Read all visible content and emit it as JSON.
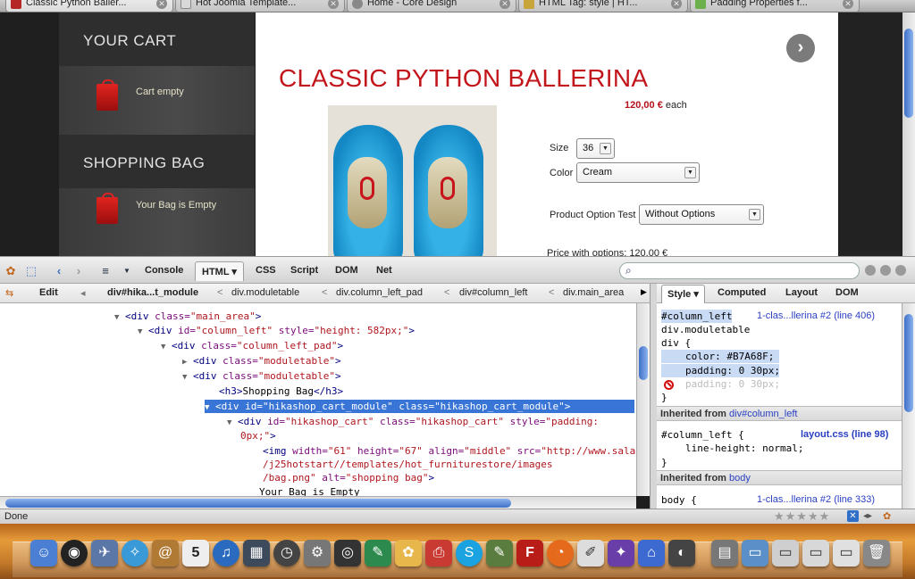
{
  "browser": {
    "tabs": [
      {
        "title": "Classic Python Baller...",
        "active": true
      },
      {
        "title": "Hot Joomla Template...",
        "active": false
      },
      {
        "title": "Home - Core Design",
        "active": false
      },
      {
        "title": "HTML Tag: style | HT...",
        "active": false
      },
      {
        "title": "Padding Properties f...",
        "active": false
      }
    ]
  },
  "site": {
    "cart": {
      "heading": "YOUR CART",
      "status": "Cart empty"
    },
    "shopping_bag": {
      "heading": "SHOPPING BAG",
      "status": "Your Bag is Empty"
    },
    "product": {
      "title": "CLASSIC PYTHON BALLERINA",
      "price": "120,00 €",
      "price_suffix": "each",
      "size_label": "Size",
      "size_value": "36",
      "color_label": "Color",
      "color_value": "Cream",
      "option_label": "Product Option Test",
      "option_value": "Without Options",
      "price_with_options": "Price with options: 120,00 €"
    },
    "accent_color": "#c3161c"
  },
  "firebug": {
    "toolbar": {
      "tabs": [
        "Console",
        "HTML",
        "CSS",
        "Script",
        "DOM",
        "Net"
      ],
      "active_tab": "HTML",
      "search_placeholder": ""
    },
    "breadcrumbs": {
      "edit_label": "Edit",
      "items": [
        "div#hika...t_module",
        "div.moduletable",
        "div.column_left_pad",
        "div#column_left",
        "div.main_area"
      ]
    },
    "html_lines": {
      "l1": {
        "tag": "<div",
        "attr": " class=",
        "val": "\"main_area\"",
        "end": ">"
      },
      "l2": {
        "tag": "<div",
        "attr": " id=",
        "val": "\"column_left\"",
        "attr2": " style=",
        "val2": "\"height: 582px;\"",
        "end": ">"
      },
      "l3": {
        "tag": "<div",
        "attr": " class=",
        "val": "\"column_left_pad\"",
        "end": ">"
      },
      "l4": {
        "tag": "<div",
        "attr": " class=",
        "val": "\"moduletable\"",
        "end": ">"
      },
      "l5": {
        "tag": "<div",
        "attr": " class=",
        "val": "\"moduletable\"",
        "end": ">"
      },
      "l6": {
        "open": "<h3>",
        "text": "Shopping Bag",
        "close": "</h3>"
      },
      "l7": {
        "tag": "<div",
        "attr": " id=",
        "val": "\"hikashop_cart_module\"",
        "attr2": " class=",
        "val2": "\"hikashop_cart_module\"",
        "end": ">"
      },
      "l8": {
        "tag": "<div",
        "attr": " id=",
        "val": "\"hikashop_cart\"",
        "attr2": " class=",
        "val2": "\"hikashop_cart\"",
        "attr3": " style=",
        "val3": "\"padding:"
      },
      "l9": {
        "val": "0px;\"",
        "end": ">"
      },
      "l10": {
        "tag": "<img",
        "attr": " width=",
        "val": "\"61\"",
        "attr2": " height=",
        "val2": "\"67\"",
        "attr3": " align=",
        "val3": "\"middle\"",
        "attr4": " src=",
        "val4": "\"http://www.salar"
      },
      "l11": {
        "val": "/j25hotstart//templates/hot_furniturestore/images"
      },
      "l12": {
        "val": "/bag.png\"",
        "attr": " alt=",
        "val2": "\"shopping bag\"",
        "end": ">"
      },
      "l13": {
        "text": "Your Bag is Empty"
      }
    },
    "side_tabs": [
      "Style",
      "Computed",
      "Layout",
      "DOM"
    ],
    "active_side_tab": "Style",
    "style_panel": {
      "rule1": {
        "selectors": [
          "#column_left",
          "div.moduletable",
          "div {"
        ],
        "source": "1-clas...llerina #2 (line 406)",
        "prop1": "color: #B7A68F;",
        "prop2": "padding: 0 30px;",
        "prop3": "padding: 0 30px;",
        "close": "}"
      },
      "inherited1": {
        "label": "Inherited from",
        "from": "div#column_left"
      },
      "rule2": {
        "selector": "#column_left {",
        "source": "layout.css (line 98)",
        "prop": "line-height: normal;",
        "close": "}"
      },
      "inherited2": {
        "label": "Inherited from",
        "from": "body"
      },
      "rule3": {
        "selector": "body {",
        "source": "1-clas...llerina #2 (line 333)"
      }
    }
  },
  "status_bar": {
    "text": "Done"
  }
}
